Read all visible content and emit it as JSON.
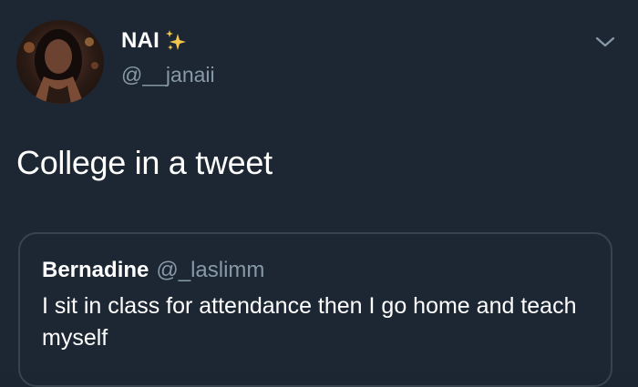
{
  "tweet": {
    "display_name": "NAI",
    "handle": "@__janaii",
    "text": "College in a tweet",
    "icons": {
      "avatar": "profile-photo",
      "name_emoji": "sparkles-icon",
      "menu": "chevron-down-icon"
    }
  },
  "quoted": {
    "display_name": "Bernadine",
    "handle": "@_laslimm",
    "text": "I sit in class for attendance then I go home and teach myself"
  },
  "colors": {
    "background": "#1c2733",
    "secondary_text": "#8899a6",
    "border": "#38444d",
    "sparkle": "#f5c84c"
  }
}
